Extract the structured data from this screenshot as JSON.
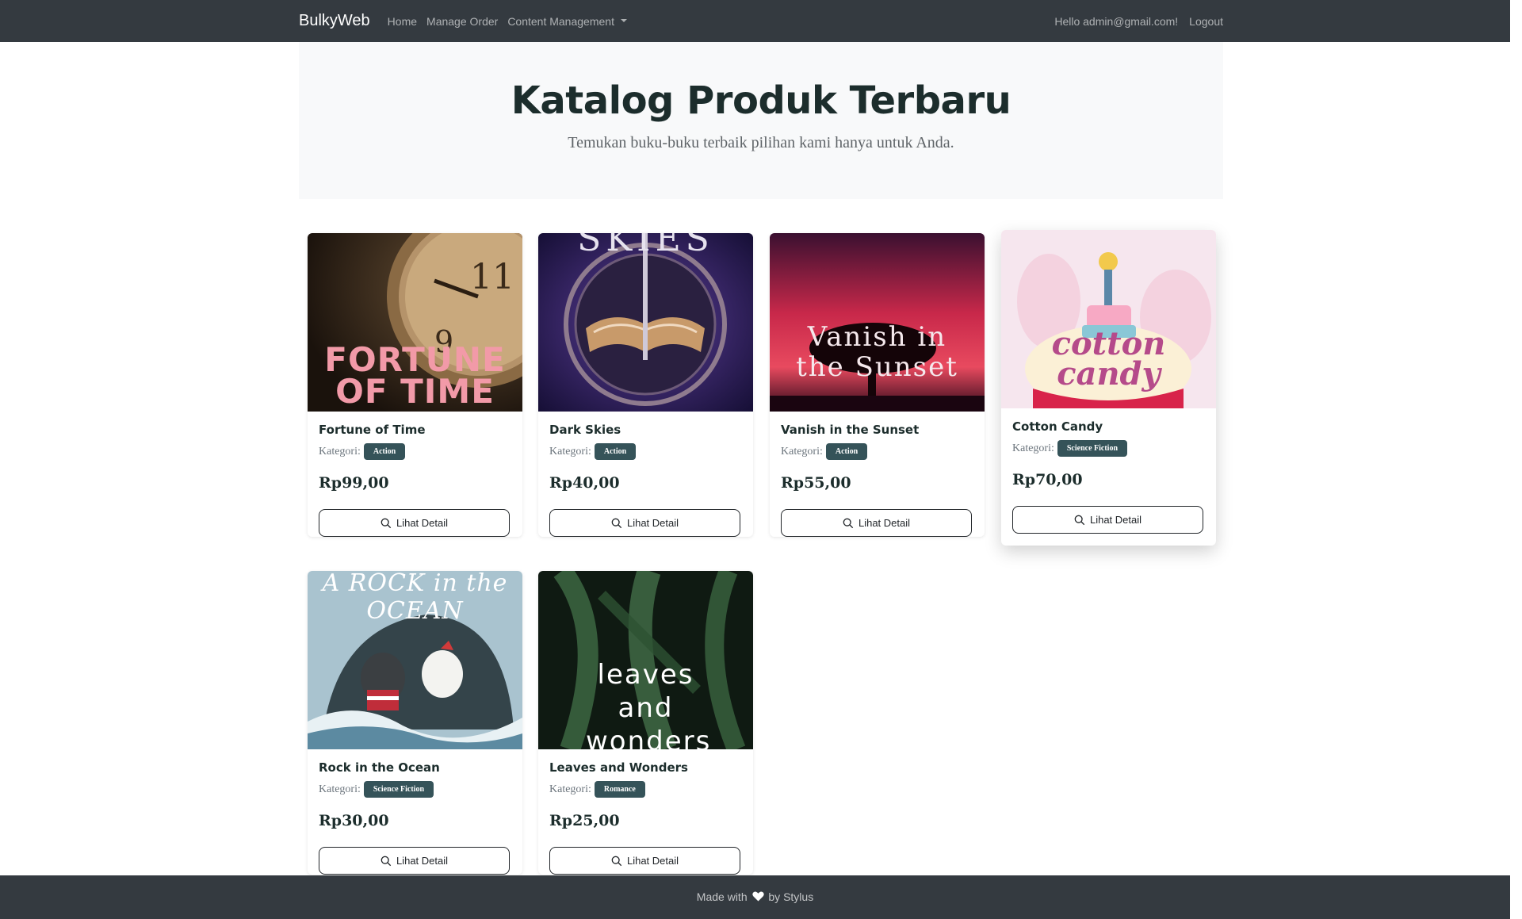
{
  "navbar": {
    "brand": "BulkyWeb",
    "links": [
      "Home",
      "Manage Order",
      "Content Management"
    ],
    "greeting": "Hello admin@gmail.com!",
    "logout": "Logout"
  },
  "hero": {
    "title": "Katalog Produk Terbaru",
    "subtitle": "Temukan buku-buku terbaik pilihan kami hanya untuk Anda."
  },
  "products": [
    {
      "title": "Fortune of Time",
      "category_label": "Kategori:",
      "category": "Action",
      "price": "Rp99,00",
      "button": "Lihat Detail",
      "cover_text": "FORTUNE OF TIME"
    },
    {
      "title": "Dark Skies",
      "category_label": "Kategori:",
      "category": "Action",
      "price": "Rp40,00",
      "button": "Lihat Detail",
      "cover_text": "SKIES"
    },
    {
      "title": "Vanish in the Sunset",
      "category_label": "Kategori:",
      "category": "Action",
      "price": "Rp55,00",
      "button": "Lihat Detail",
      "cover_text": "Vanish in the Sunset"
    },
    {
      "title": "Cotton Candy",
      "category_label": "Kategori:",
      "category": "Science Fiction",
      "price": "Rp70,00",
      "button": "Lihat Detail",
      "cover_text": "cotton candy"
    },
    {
      "title": "Rock in the Ocean",
      "category_label": "Kategori:",
      "category": "Science Fiction",
      "price": "Rp30,00",
      "button": "Lihat Detail",
      "cover_text": "A ROCK in the OCEAN"
    },
    {
      "title": "Leaves and Wonders",
      "category_label": "Kategori:",
      "category": "Romance",
      "price": "Rp25,00",
      "button": "Lihat Detail",
      "cover_text": "leaves and wonders"
    }
  ],
  "footer": {
    "prefix": "Made with",
    "suffix": "by Stylus"
  },
  "colors": {
    "navbar": "#343a40",
    "badge": "#355359",
    "title": "#1c2d2c"
  }
}
